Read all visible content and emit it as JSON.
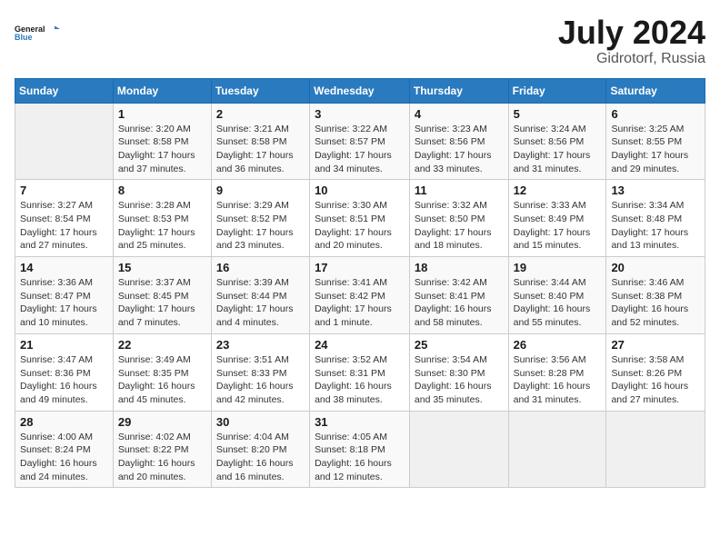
{
  "header": {
    "logo_line1": "General",
    "logo_line2": "Blue",
    "month": "July 2024",
    "location": "Gidrotorf, Russia"
  },
  "weekdays": [
    "Sunday",
    "Monday",
    "Tuesday",
    "Wednesday",
    "Thursday",
    "Friday",
    "Saturday"
  ],
  "weeks": [
    [
      {
        "day": "",
        "info": ""
      },
      {
        "day": "1",
        "info": "Sunrise: 3:20 AM\nSunset: 8:58 PM\nDaylight: 17 hours\nand 37 minutes."
      },
      {
        "day": "2",
        "info": "Sunrise: 3:21 AM\nSunset: 8:58 PM\nDaylight: 17 hours\nand 36 minutes."
      },
      {
        "day": "3",
        "info": "Sunrise: 3:22 AM\nSunset: 8:57 PM\nDaylight: 17 hours\nand 34 minutes."
      },
      {
        "day": "4",
        "info": "Sunrise: 3:23 AM\nSunset: 8:56 PM\nDaylight: 17 hours\nand 33 minutes."
      },
      {
        "day": "5",
        "info": "Sunrise: 3:24 AM\nSunset: 8:56 PM\nDaylight: 17 hours\nand 31 minutes."
      },
      {
        "day": "6",
        "info": "Sunrise: 3:25 AM\nSunset: 8:55 PM\nDaylight: 17 hours\nand 29 minutes."
      }
    ],
    [
      {
        "day": "7",
        "info": "Sunrise: 3:27 AM\nSunset: 8:54 PM\nDaylight: 17 hours\nand 27 minutes."
      },
      {
        "day": "8",
        "info": "Sunrise: 3:28 AM\nSunset: 8:53 PM\nDaylight: 17 hours\nand 25 minutes."
      },
      {
        "day": "9",
        "info": "Sunrise: 3:29 AM\nSunset: 8:52 PM\nDaylight: 17 hours\nand 23 minutes."
      },
      {
        "day": "10",
        "info": "Sunrise: 3:30 AM\nSunset: 8:51 PM\nDaylight: 17 hours\nand 20 minutes."
      },
      {
        "day": "11",
        "info": "Sunrise: 3:32 AM\nSunset: 8:50 PM\nDaylight: 17 hours\nand 18 minutes."
      },
      {
        "day": "12",
        "info": "Sunrise: 3:33 AM\nSunset: 8:49 PM\nDaylight: 17 hours\nand 15 minutes."
      },
      {
        "day": "13",
        "info": "Sunrise: 3:34 AM\nSunset: 8:48 PM\nDaylight: 17 hours\nand 13 minutes."
      }
    ],
    [
      {
        "day": "14",
        "info": "Sunrise: 3:36 AM\nSunset: 8:47 PM\nDaylight: 17 hours\nand 10 minutes."
      },
      {
        "day": "15",
        "info": "Sunrise: 3:37 AM\nSunset: 8:45 PM\nDaylight: 17 hours\nand 7 minutes."
      },
      {
        "day": "16",
        "info": "Sunrise: 3:39 AM\nSunset: 8:44 PM\nDaylight: 17 hours\nand 4 minutes."
      },
      {
        "day": "17",
        "info": "Sunrise: 3:41 AM\nSunset: 8:42 PM\nDaylight: 17 hours\nand 1 minute."
      },
      {
        "day": "18",
        "info": "Sunrise: 3:42 AM\nSunset: 8:41 PM\nDaylight: 16 hours\nand 58 minutes."
      },
      {
        "day": "19",
        "info": "Sunrise: 3:44 AM\nSunset: 8:40 PM\nDaylight: 16 hours\nand 55 minutes."
      },
      {
        "day": "20",
        "info": "Sunrise: 3:46 AM\nSunset: 8:38 PM\nDaylight: 16 hours\nand 52 minutes."
      }
    ],
    [
      {
        "day": "21",
        "info": "Sunrise: 3:47 AM\nSunset: 8:36 PM\nDaylight: 16 hours\nand 49 minutes."
      },
      {
        "day": "22",
        "info": "Sunrise: 3:49 AM\nSunset: 8:35 PM\nDaylight: 16 hours\nand 45 minutes."
      },
      {
        "day": "23",
        "info": "Sunrise: 3:51 AM\nSunset: 8:33 PM\nDaylight: 16 hours\nand 42 minutes."
      },
      {
        "day": "24",
        "info": "Sunrise: 3:52 AM\nSunset: 8:31 PM\nDaylight: 16 hours\nand 38 minutes."
      },
      {
        "day": "25",
        "info": "Sunrise: 3:54 AM\nSunset: 8:30 PM\nDaylight: 16 hours\nand 35 minutes."
      },
      {
        "day": "26",
        "info": "Sunrise: 3:56 AM\nSunset: 8:28 PM\nDaylight: 16 hours\nand 31 minutes."
      },
      {
        "day": "27",
        "info": "Sunrise: 3:58 AM\nSunset: 8:26 PM\nDaylight: 16 hours\nand 27 minutes."
      }
    ],
    [
      {
        "day": "28",
        "info": "Sunrise: 4:00 AM\nSunset: 8:24 PM\nDaylight: 16 hours\nand 24 minutes."
      },
      {
        "day": "29",
        "info": "Sunrise: 4:02 AM\nSunset: 8:22 PM\nDaylight: 16 hours\nand 20 minutes."
      },
      {
        "day": "30",
        "info": "Sunrise: 4:04 AM\nSunset: 8:20 PM\nDaylight: 16 hours\nand 16 minutes."
      },
      {
        "day": "31",
        "info": "Sunrise: 4:05 AM\nSunset: 8:18 PM\nDaylight: 16 hours\nand 12 minutes."
      },
      {
        "day": "",
        "info": ""
      },
      {
        "day": "",
        "info": ""
      },
      {
        "day": "",
        "info": ""
      }
    ]
  ]
}
